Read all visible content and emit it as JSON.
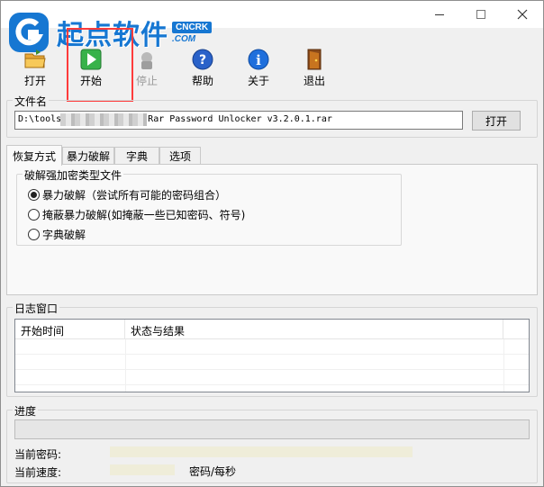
{
  "titlebar": {
    "minimize_glyph": "—",
    "maximize_glyph": "☐",
    "close_glyph": "✕"
  },
  "watermark": {
    "text": "起点软件",
    "badge_top": "CNCRK",
    "badge_bottom": ".COM"
  },
  "toolbar": {
    "items": [
      {
        "label": "打开",
        "icon": "open-folder-icon",
        "enabled": true
      },
      {
        "label": "开始",
        "icon": "play-icon",
        "enabled": true
      },
      {
        "label": "停止",
        "icon": "stop-icon",
        "enabled": false
      },
      {
        "label": "帮助",
        "icon": "help-icon",
        "enabled": true
      },
      {
        "label": "关于",
        "icon": "info-icon",
        "enabled": true
      },
      {
        "label": "退出",
        "icon": "exit-door-icon",
        "enabled": true
      }
    ]
  },
  "file": {
    "group_title": "文件名",
    "path_prefix": "D:\\tools",
    "path_suffix": "Rar Password Unlocker v3.2.0.1.rar",
    "open_button": "打开"
  },
  "tabs": [
    {
      "label": "恢复方式",
      "active": true
    },
    {
      "label": "暴力破解",
      "active": false
    },
    {
      "label": "字典",
      "active": false
    },
    {
      "label": "选项",
      "active": false
    }
  ],
  "mode": {
    "group_title": "破解强加密类型文件",
    "options": [
      {
        "label": "暴力破解（尝试所有可能的密码组合）",
        "selected": true
      },
      {
        "label": "掩蔽暴力破解(如掩蔽一些已知密码、符号)",
        "selected": false
      },
      {
        "label": "字典破解",
        "selected": false
      }
    ]
  },
  "log": {
    "group_title": "日志窗口",
    "columns": [
      "开始时间",
      "状态与结果",
      ""
    ]
  },
  "progress": {
    "group_title": "进度",
    "value_percent": 0,
    "current_password_label": "当前密码:",
    "current_speed_label": "当前速度:",
    "speed_unit": "密码/每秒"
  },
  "colors": {
    "accent": "#1677d2",
    "highlight": "#ff3b3b",
    "window_bg": "#f0f0f0"
  }
}
